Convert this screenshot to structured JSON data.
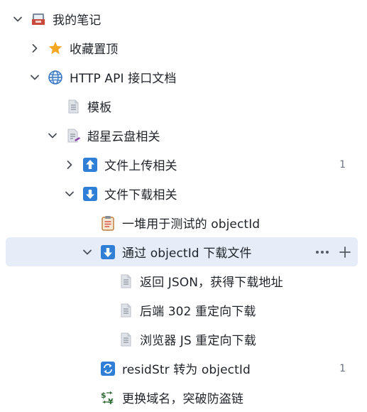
{
  "tree": {
    "items": [
      {
        "label": "我的笔记",
        "icon": "inbox-tray-icon",
        "chevron": "down"
      },
      {
        "label": "收藏置顶",
        "icon": "star-icon",
        "chevron": "right"
      },
      {
        "label": "HTTP API 接口文档",
        "icon": "globe-icon",
        "chevron": "down"
      },
      {
        "label": "模板",
        "icon": "document-icon",
        "chevron": "none"
      },
      {
        "label": "超星云盘相关",
        "icon": "document-pen-icon",
        "chevron": "down"
      },
      {
        "label": "文件上传相关",
        "icon": "upload-arrow-icon",
        "chevron": "right",
        "count": "1"
      },
      {
        "label": "文件下载相关",
        "icon": "download-arrow-icon",
        "chevron": "down"
      },
      {
        "label": "一堆用于测试的 objectId",
        "icon": "clipboard-icon",
        "chevron": "none"
      },
      {
        "label": "通过 objectId 下载文件",
        "icon": "download-arrow-icon",
        "chevron": "down",
        "selected": true
      },
      {
        "label": "返回 JSON，获得下载地址",
        "icon": "document-icon",
        "chevron": "none"
      },
      {
        "label": "后端 302 重定向下载",
        "icon": "document-icon",
        "chevron": "none"
      },
      {
        "label": "浏览器 JS 重定向下载",
        "icon": "document-icon",
        "chevron": "none"
      },
      {
        "label": "residStr 转为 objectId",
        "icon": "sync-arrows-icon",
        "chevron": "none",
        "count": "1"
      },
      {
        "label": "更换域名，突破防盗链",
        "icon": "currency-exchange-icon",
        "chevron": "none"
      }
    ],
    "selected_actions": {
      "more": "more-dots-icon",
      "add": "plus-icon"
    }
  },
  "colors": {
    "selected_bg": "#e6ecf8",
    "arrow_blue": "#2f7fd6",
    "star": "#f5a623",
    "text": "#1f2329",
    "muted": "#6b7280"
  }
}
